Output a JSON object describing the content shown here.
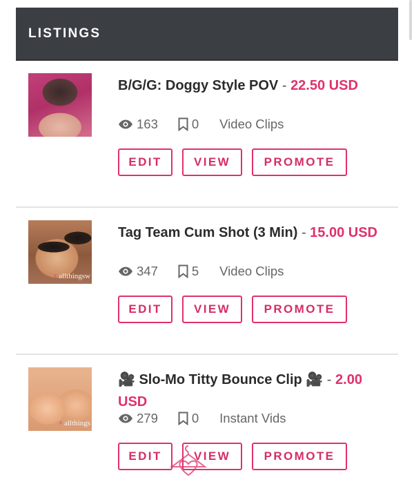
{
  "header": {
    "title": "LISTINGS"
  },
  "icons": {
    "views": "eye-icon",
    "saves": "bookmark-icon",
    "watermark": "hanger-logo-icon"
  },
  "colors": {
    "accent": "#e0306b",
    "header_bg": "#3b3f44"
  },
  "listings": [
    {
      "title": "B/G/G: Doggy Style POV",
      "dash": "-",
      "price": "22.50 USD",
      "views": "163",
      "saves": "0",
      "category": "Video Clips",
      "watermark": "",
      "buttons": {
        "edit": "EDIT",
        "view": "VIEW",
        "promote": "PROMOTE"
      }
    },
    {
      "title": "Tag Team Cum Shot (3 Min)",
      "dash": "-",
      "price": "15.00 USD",
      "views": "347",
      "saves": "5",
      "category": "Video Clips",
      "watermark": "allthingsw",
      "buttons": {
        "edit": "EDIT",
        "view": "VIEW",
        "promote": "PROMOTE"
      }
    },
    {
      "title": "🎥 Slo-Mo Titty Bounce Clip 🎥",
      "dash": "-",
      "price": "2.00 USD",
      "views": "279",
      "saves": "0",
      "category": "Instant Vids",
      "watermark": "allthings",
      "buttons": {
        "edit": "EDIT",
        "view": "VIEW",
        "promote": "PROMOTE"
      }
    }
  ]
}
